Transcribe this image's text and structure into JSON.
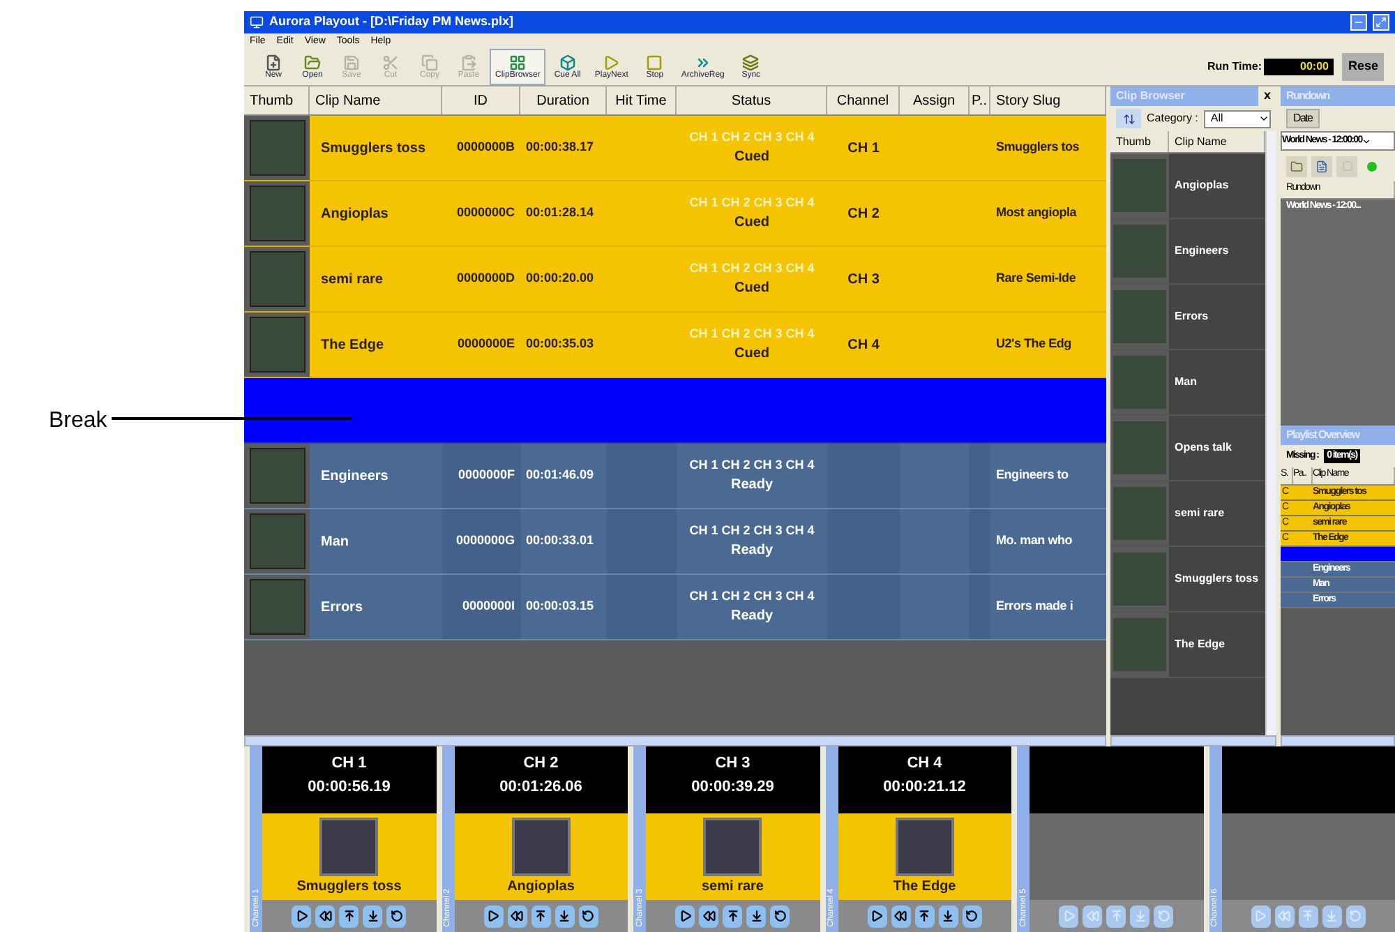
{
  "window": {
    "title": "Aurora Playout - [D:\\Friday PM News.plx]"
  },
  "menu": [
    "File",
    "Edit",
    "View",
    "Tools",
    "Help"
  ],
  "toolbar": [
    {
      "label": "New",
      "disabled": false,
      "pressed": false
    },
    {
      "label": "Open",
      "disabled": false,
      "pressed": false
    },
    {
      "label": "Save",
      "disabled": true,
      "pressed": false
    },
    {
      "label": "Cut",
      "disabled": true,
      "pressed": false
    },
    {
      "label": "Copy",
      "disabled": true,
      "pressed": false
    },
    {
      "label": "Paste",
      "disabled": true,
      "pressed": false
    },
    {
      "label": "ClipBrowser",
      "disabled": false,
      "pressed": true
    },
    {
      "label": "Cue All",
      "disabled": false,
      "pressed": false
    },
    {
      "label": "PlayNext",
      "disabled": false,
      "pressed": false
    },
    {
      "label": "Stop",
      "disabled": false,
      "pressed": false
    },
    {
      "label": "ArchiveReg",
      "disabled": false,
      "pressed": false
    },
    {
      "label": "Sync",
      "disabled": false,
      "pressed": false
    }
  ],
  "run_time": {
    "label": "Run Time:",
    "value": "00:00",
    "button": "Rese"
  },
  "playlist": {
    "columns": [
      "Thumb",
      "Clip Name",
      "ID",
      "Duration",
      "Hit Time",
      "Status",
      "Channel",
      "Assign",
      "P..",
      "Story Slug"
    ],
    "rows": [
      {
        "kind": "cued",
        "clip_name": "Smugglers toss",
        "id": "0000000B",
        "duration": "00:00:38.17",
        "channels_line": "CH 1 CH 2 CH 3 CH 4",
        "status": "Cued",
        "channel": "CH 1",
        "story_slug": "Smugglers tos"
      },
      {
        "kind": "cued",
        "clip_name": "Angioplas",
        "id": "0000000C",
        "duration": "00:01:28.14",
        "channels_line": "CH 1 CH 2 CH 3 CH 4",
        "status": "Cued",
        "channel": "CH 2",
        "story_slug": "Most angiopla"
      },
      {
        "kind": "cued",
        "clip_name": "semi rare",
        "id": "0000000D",
        "duration": "00:00:20.00",
        "channels_line": "CH 1 CH 2 CH 3 CH 4",
        "status": "Cued",
        "channel": "CH 3",
        "story_slug": "Rare Semi-Ide"
      },
      {
        "kind": "cued",
        "clip_name": "The Edge",
        "id": "0000000E",
        "duration": "00:00:35.03",
        "channels_line": "CH 1 CH 2 CH 3 CH 4",
        "status": "Cued",
        "channel": "CH 4",
        "story_slug": "U2's The Edg"
      },
      {
        "kind": "break"
      },
      {
        "kind": "ready",
        "clip_name": "Engineers",
        "id": "0000000F",
        "duration": "00:01:46.09",
        "channels_line": "CH 1 CH 2 CH 3 CH 4",
        "status": "Ready",
        "story_slug": "Engineers to"
      },
      {
        "kind": "ready",
        "clip_name": "Man",
        "id": "0000000G",
        "duration": "00:00:33.01",
        "channels_line": "CH 1 CH 2 CH 3 CH 4",
        "status": "Ready",
        "story_slug": "Mo. man who"
      },
      {
        "kind": "ready",
        "clip_name": "Errors",
        "id": "0000000I",
        "duration": "00:00:03.15",
        "channels_line": "CH 1 CH 2 CH 3 CH 4",
        "status": "Ready",
        "story_slug": "Errors made i"
      }
    ]
  },
  "clip_browser": {
    "title": "Clip Browser",
    "close": "x",
    "category_label": "Category :",
    "category": "All",
    "columns": [
      "Thumb",
      "Clip Name"
    ],
    "items": [
      "Angioplas",
      "Engineers",
      "Errors",
      "Man",
      "Opens talk",
      "semi rare",
      "Smugglers toss",
      "The Edge"
    ]
  },
  "rundown": {
    "title": "Rundown",
    "date_button": "Date",
    "selector": "World News - 12:00:00",
    "columns": [
      "Rundown"
    ],
    "rows": [
      "World News - 12:00..."
    ]
  },
  "playlist_overview": {
    "title": "Playlist Overview",
    "missing_label": "Missing :",
    "missing": "0 item(s)",
    "columns": [
      "S.",
      "Pa..",
      "Clip Name"
    ],
    "rows": [
      {
        "kind": "cued",
        "s": "C",
        "clip_name": "Smugglers tos"
      },
      {
        "kind": "cued",
        "s": "C",
        "clip_name": "Angioplas"
      },
      {
        "kind": "cued",
        "s": "C",
        "clip_name": "semi rare"
      },
      {
        "kind": "cued",
        "s": "C",
        "clip_name": "The Edge"
      },
      {
        "kind": "break"
      },
      {
        "kind": "ready",
        "clip_name": "Engineers"
      },
      {
        "kind": "ready",
        "clip_name": "Man"
      },
      {
        "kind": "ready",
        "clip_name": "Errors"
      }
    ]
  },
  "channels": [
    {
      "tab": "Channel 1",
      "kind": "loaded",
      "name": "CH 1",
      "time": "00:00:56.19",
      "clip": "Smugglers toss"
    },
    {
      "tab": "Channel 2",
      "kind": "loaded",
      "name": "CH 2",
      "time": "00:01:26.06",
      "clip": "Angioplas"
    },
    {
      "tab": "Channel 3",
      "kind": "loaded",
      "name": "CH 3",
      "time": "00:00:39.29",
      "clip": "semi rare"
    },
    {
      "tab": "Channel 4",
      "kind": "loaded",
      "name": "CH 4",
      "time": "00:00:21.12",
      "clip": "The Edge"
    },
    {
      "tab": "Channel 5",
      "kind": "empty"
    },
    {
      "tab": "Channel 6",
      "kind": "empty"
    }
  ],
  "callout": {
    "label": "Break"
  }
}
